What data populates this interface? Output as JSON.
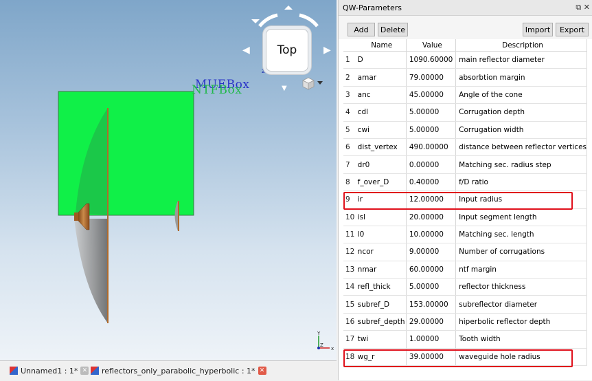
{
  "viewport": {
    "nav_cube_label": "Top",
    "labels3d": [
      "MUEBox",
      "NTFBox"
    ],
    "axis_labels": {
      "y": "Y",
      "z": "Z",
      "x": "x"
    },
    "gizmo_z": "z",
    "colors": {
      "box": "#10f048",
      "dish": "#8a8a8a",
      "copper": "#b06a2a",
      "label_blue": "#2a34c8",
      "label_green": "#21b84a"
    }
  },
  "tabs": [
    {
      "label": "Unnamed1 : 1*",
      "active": false
    },
    {
      "label": "reflectors_only_parabolic_hyperbolic : 1*",
      "active": true
    }
  ],
  "panel": {
    "title": "QW-Parameters",
    "window_controls": "⧉ ✕",
    "buttons": {
      "add": "Add",
      "delete": "Delete",
      "import": "Import",
      "export": "Export"
    },
    "columns": [
      "",
      "Name",
      "Value",
      "Description"
    ],
    "rows": [
      {
        "idx": "1",
        "name": "D",
        "value": "1090.60000",
        "desc": "main reflector diameter"
      },
      {
        "idx": "2",
        "name": "amar",
        "value": "79.00000",
        "desc": "absorbtion margin"
      },
      {
        "idx": "3",
        "name": "anc",
        "value": "45.00000",
        "desc": "Angle of the cone"
      },
      {
        "idx": "4",
        "name": "cdl",
        "value": "5.00000",
        "desc": "Corrugation depth"
      },
      {
        "idx": "5",
        "name": "cwi",
        "value": "5.00000",
        "desc": "Corrugation width"
      },
      {
        "idx": "6",
        "name": "dist_vertex",
        "value": "490.00000",
        "desc": "distance between reflector vertices"
      },
      {
        "idx": "7",
        "name": "dr0",
        "value": "0.00000",
        "desc": "Matching sec. radius step"
      },
      {
        "idx": "8",
        "name": "f_over_D",
        "value": "0.40000",
        "desc": "f/D ratio"
      },
      {
        "idx": "9",
        "name": "ir",
        "value": "12.00000",
        "desc": "Input radius"
      },
      {
        "idx": "10",
        "name": "isl",
        "value": "20.00000",
        "desc": "Input segment length"
      },
      {
        "idx": "11",
        "name": "l0",
        "value": "10.00000",
        "desc": "Matching sec. length"
      },
      {
        "idx": "12",
        "name": "ncor",
        "value": "9.00000",
        "desc": "Number of corrugations"
      },
      {
        "idx": "13",
        "name": "nmar",
        "value": "60.00000",
        "desc": "ntf margin"
      },
      {
        "idx": "14",
        "name": "refl_thick",
        "value": "5.00000",
        "desc": "reflector thickness"
      },
      {
        "idx": "15",
        "name": "subref_D",
        "value": "153.00000",
        "desc": "subreflector diameter"
      },
      {
        "idx": "16",
        "name": "subref_depth",
        "value": "29.00000",
        "desc": "hiperbolic reflector depth"
      },
      {
        "idx": "17",
        "name": "twi",
        "value": "1.00000",
        "desc": "Tooth width"
      },
      {
        "idx": "18",
        "name": "wg_r",
        "value": "39.00000",
        "desc": "waveguide hole radius"
      }
    ],
    "highlighted_rows": [
      "9",
      "18"
    ],
    "highlight_color": "#e0101b"
  }
}
